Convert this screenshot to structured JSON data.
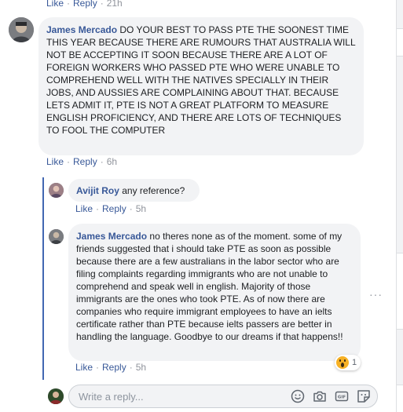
{
  "top_actions": {
    "like": "Like",
    "reply": "Reply",
    "time": "21h"
  },
  "comment1": {
    "author": "James Mercado",
    "text": "DO YOUR BEST TO PASS PTE THE SOONEST TIME THIS YEAR BECAUSE THERE ARE RUMOURS THAT AUSTRALIA WILL NOT BE ACCEPTING IT SOON BECAUSE THERE ARE A LOT OF FOREIGN WORKERS WHO PASSED PTE WHO WERE UNABLE TO COMPREHEND WELL WITH THE NATIVES SPECIALLY IN THEIR JOBS, AND AUSSIES ARE COMPLAINING ABOUT THAT. BECAUSE LETS ADMIT IT, PTE IS NOT A GREAT PLATFORM TO MEASURE ENGLISH PROFICIENCY, AND THERE ARE LOTS OF TECHNIQUES TO FOOL THE COMPUTER",
    "actions": {
      "like": "Like",
      "reply": "Reply",
      "time": "6h"
    }
  },
  "reply1": {
    "author": "Avijit Roy",
    "text": "any reference?",
    "actions": {
      "like": "Like",
      "reply": "Reply",
      "time": "5h"
    }
  },
  "reply2": {
    "author": "James Mercado",
    "text": "no theres none as of the moment. some of my friends suggested that i should take PTE as soon as possible because there are a few australians in the labor sector who are filing complaints regarding immigrants who are not unable to comprehend and speak well in english. Majority of those immigrants are the ones who took PTE. As of now there are companies who require immigrant employees to have an ielts certificate rather than PTE because ielts passers are better in handling the language. Goodbye to our dreams if that happens!!",
    "actions": {
      "like": "Like",
      "reply": "Reply",
      "time": "5h"
    },
    "reaction": {
      "icon": "wow-reaction-icon",
      "count": "1"
    }
  },
  "more_options": "···",
  "reply_box": {
    "placeholder": "Write a reply..."
  },
  "colors": {
    "link": "#385898",
    "bubble": "#f2f3f5",
    "thread": "#4267b2",
    "meta": "#90949c"
  }
}
